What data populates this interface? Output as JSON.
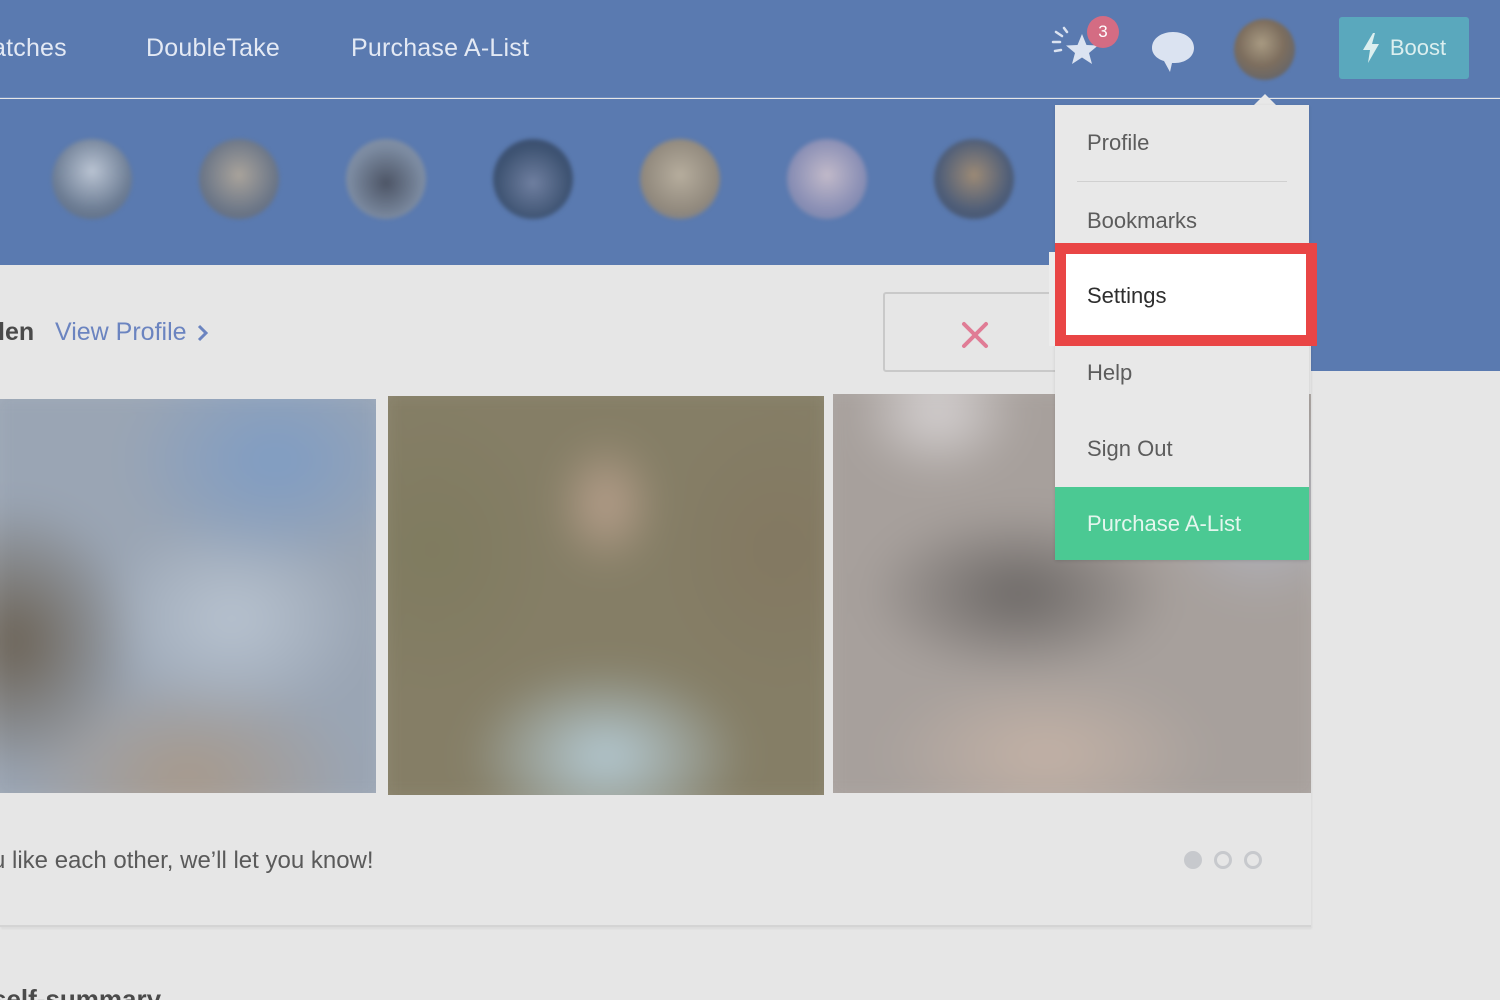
{
  "nav": {
    "matches_label": "atches",
    "doubletake_label": "DoubleTake",
    "purchase_label": "Purchase A-List",
    "notification_count": "3",
    "boost_label": "Boost"
  },
  "profile_card": {
    "name_fragment": "len",
    "view_profile_label": "View Profile",
    "match_message": "u like each other, we’ll let you know!",
    "photo_count": 3,
    "active_photo_index": 0
  },
  "section_heading": "self-summary",
  "dropdown": {
    "items": [
      {
        "label": "Profile"
      },
      {
        "label": "Bookmarks"
      },
      {
        "label": "Settings"
      },
      {
        "label": "Help"
      },
      {
        "label": "Sign Out"
      },
      {
        "label": "Purchase A-List"
      }
    ]
  },
  "colors": {
    "nav_blue": "#5a7ab0",
    "boost_teal": "#5aa8bd",
    "purchase_green": "#4bc993",
    "badge_pink": "#d46c83",
    "highlight_red": "#e94545",
    "link_blue": "#6b84c0"
  }
}
